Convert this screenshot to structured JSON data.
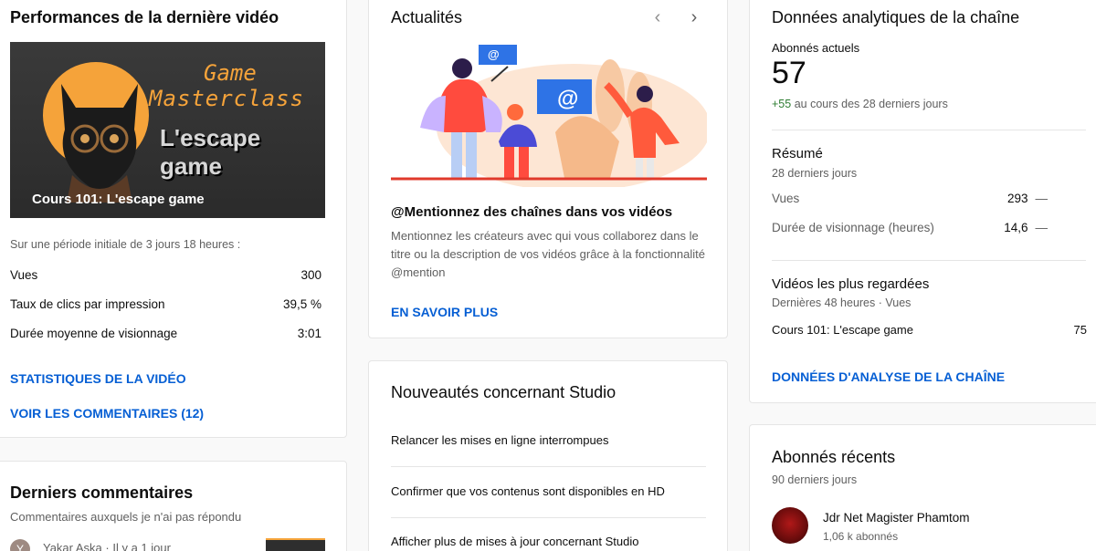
{
  "latest_video": {
    "title": "Performances de la dernière vidéo",
    "thumb_line1": "Game",
    "thumb_line2": "Masterclass",
    "thumb_line3": "L'escape game",
    "video_title": "Cours 101: L'escape game",
    "period": "Sur une période initiale de 3 jours 18 heures :",
    "stats": [
      {
        "label": "Vues",
        "value": "300"
      },
      {
        "label": "Taux de clics par impression",
        "value": "39,5 %"
      },
      {
        "label": "Durée moyenne de visionnage",
        "value": "3:01"
      }
    ],
    "link_stats": "STATISTIQUES DE LA VIDÉO",
    "link_comments": "VOIR LES COMMENTAIRES (12)"
  },
  "comments": {
    "title": "Derniers commentaires",
    "subtitle": "Commentaires auxquels je n'ai pas répondu",
    "first_author_initial": "Y",
    "first_author": "Yakar Aska · Il y a 1 jour"
  },
  "news": {
    "title": "Actualités",
    "headline": "@Mentionnez des chaînes dans vos vidéos",
    "body": "Mentionnez les créateurs avec qui vous collaborez dans le titre ou la description de vos vidéos grâce à la fonctionnalité @mention",
    "link": "EN SAVOIR PLUS",
    "at_symbol": "@"
  },
  "studio_updates": {
    "title": "Nouveautés concernant Studio",
    "items": [
      "Relancer les mises en ligne interrompues",
      "Confirmer que vos contenus sont disponibles en HD",
      "Afficher plus de mises à jour concernant Studio"
    ]
  },
  "analytics": {
    "title": "Données analytiques de la chaîne",
    "subs_label": "Abonnés actuels",
    "subs_value": "57",
    "subs_delta": "+55",
    "subs_delta_text": "au cours des 28 derniers jours",
    "summary_title": "Résumé",
    "summary_period": "28 derniers jours",
    "summary": [
      {
        "label": "Vues",
        "value": "293",
        "trend": "—"
      },
      {
        "label": "Durée de visionnage (heures)",
        "value": "14,6",
        "trend": "—"
      }
    ],
    "top_title": "Vidéos les plus regardées",
    "top_period": "Dernières 48 heures · Vues",
    "top_video": "Cours 101: L'escape game",
    "top_views": "75",
    "link": "DONNÉES D'ANALYSE DE LA CHAÎNE"
  },
  "recent_subs": {
    "title": "Abonnés récents",
    "period": "90 derniers jours",
    "name": "Jdr Net Magister Phamtom",
    "count": "1,06 k abonnés"
  },
  "colors": {
    "accent_link": "#065fd4",
    "positive": "#2e7d32",
    "thumb_orange": "#f5a33a"
  }
}
